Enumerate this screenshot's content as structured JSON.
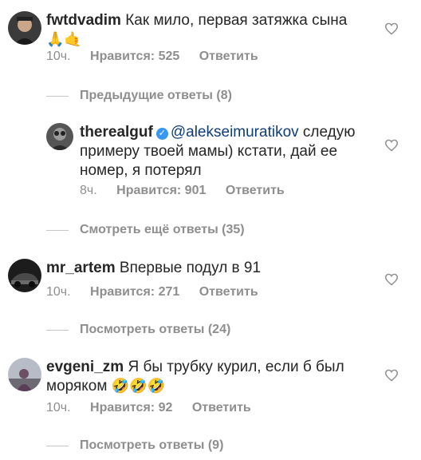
{
  "comments": [
    {
      "username": "fwtdvadim",
      "text": "Как мило, первая затяжка сына",
      "emojis": [
        "🙏",
        "🤙"
      ],
      "time": "10ч.",
      "likes": "Нравится: 525",
      "reply": "Ответить"
    },
    {
      "username": "therealguf",
      "mention": "@alekseimuratikov",
      "text_line1": " следую",
      "text_line2": "примеру твоей мамы) кстати, дай ее",
      "text_line3": "номер, я потерял",
      "time": "8ч.",
      "likes": "Нравится: 901",
      "reply": "Ответить"
    },
    {
      "username": "mr_artem",
      "text": "Впервые подул в 91",
      "time": "10ч.",
      "likes": "Нравится: 271",
      "reply": "Ответить"
    },
    {
      "username": "evgeni_zm",
      "text_line1": "Я бы трубку курил, если б был",
      "text_line2": "моряком",
      "emojis": [
        "🤣",
        "🤣",
        "🤣"
      ],
      "time": "10ч.",
      "likes": "Нравится: 92",
      "reply": "Ответить"
    }
  ],
  "reply_links": {
    "previous": "Предыдущие ответы (8)",
    "more": "Смотреть ещё ответы (35)",
    "view_artem": "Посмотреть ответы (24)",
    "view_evgeni": "Посмотреть ответы (9)"
  },
  "colors": {
    "text": "#262626",
    "meta": "#8e8e8e",
    "mention": "#0e3e7a",
    "verified": "#3897f0"
  }
}
